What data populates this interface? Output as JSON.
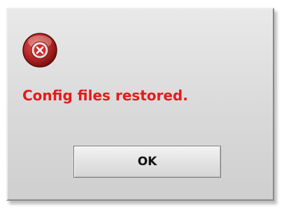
{
  "dialog": {
    "icon": "error-icon",
    "message": "Config files restored.",
    "ok_label": "OK"
  },
  "colors": {
    "message_text": "#e41b1b",
    "icon_ring": "#a61e1e",
    "dialog_background": "#dcdcdc"
  }
}
